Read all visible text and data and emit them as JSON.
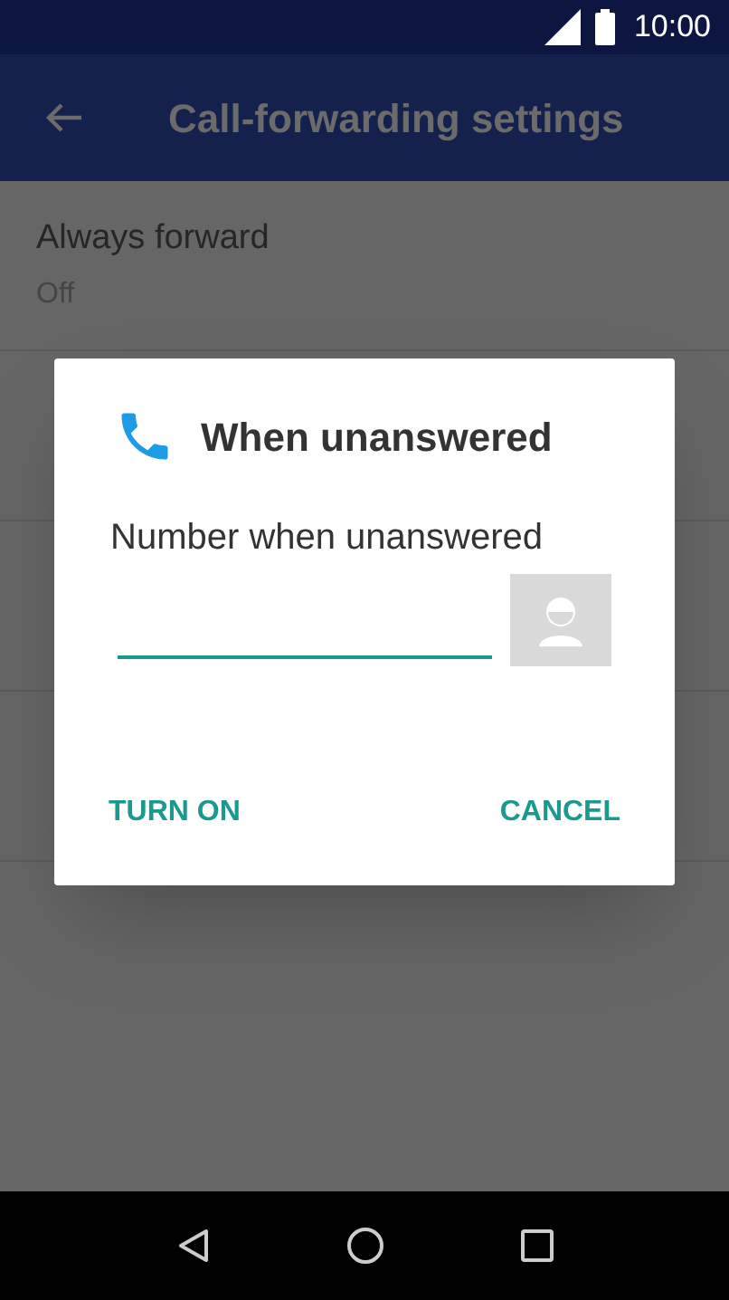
{
  "status_bar": {
    "time": "10:00"
  },
  "app_bar": {
    "title": "Call-forwarding settings"
  },
  "settings": [
    {
      "title": "Always forward",
      "value": "Off"
    }
  ],
  "dialog": {
    "title": "When unanswered",
    "label": "Number when unanswered",
    "buttons": [
      {
        "label": "TURN ON"
      },
      {
        "label": "CANCEL"
      }
    ]
  }
}
